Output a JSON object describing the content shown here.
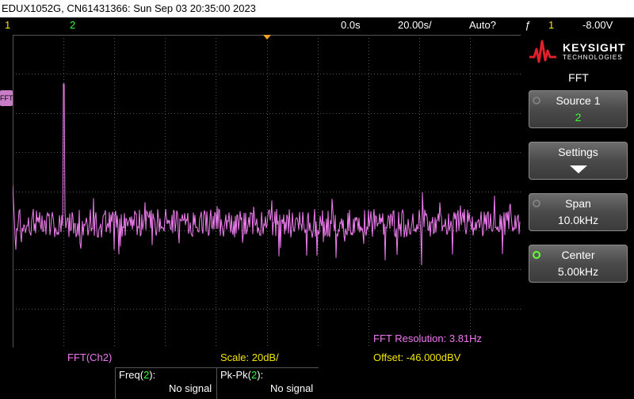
{
  "title": "EDUX1052G, CN61431366: Sun Sep 03 20:35:00 2023",
  "status": {
    "ch1": "1",
    "ch2": "2",
    "time_delay": "0.0s",
    "time_scale": "20.00s/",
    "trigger_mode": "Auto?",
    "trigger_icon": "ƒ",
    "trigger_source": "1",
    "trigger_level": "-8.00V"
  },
  "graticule": {
    "fft_marker": "FFT",
    "fft_resolution": "FFT Resolution: 3.81Hz"
  },
  "bottom": {
    "fft_source": "FFT(Ch2)",
    "scale": "Scale: 20dB/",
    "offset": "Offset: -46.000dBV"
  },
  "measurements": [
    {
      "name_prefix": "Freq(",
      "channel": "2",
      "name_suffix": "):",
      "value": "No signal"
    },
    {
      "name_prefix": "Pk-Pk(",
      "channel": "2",
      "name_suffix": "):",
      "value": "No signal"
    }
  ],
  "logo": {
    "brand": "KEYSIGHT",
    "sub": "TECHNOLOGIES",
    "color": "#e0202b"
  },
  "menu": {
    "title": "FFT",
    "softkeys": [
      {
        "label": "Source 1",
        "value": "2"
      },
      {
        "label": "Settings",
        "value": ""
      },
      {
        "label": "Span",
        "value": "10.0kHz"
      },
      {
        "label": "Center",
        "value": "5.00kHz"
      }
    ]
  },
  "colors": {
    "trace": "#f07ef0",
    "ch1": "#f2e600",
    "ch2": "#33ff33",
    "grid": "#555555"
  }
}
